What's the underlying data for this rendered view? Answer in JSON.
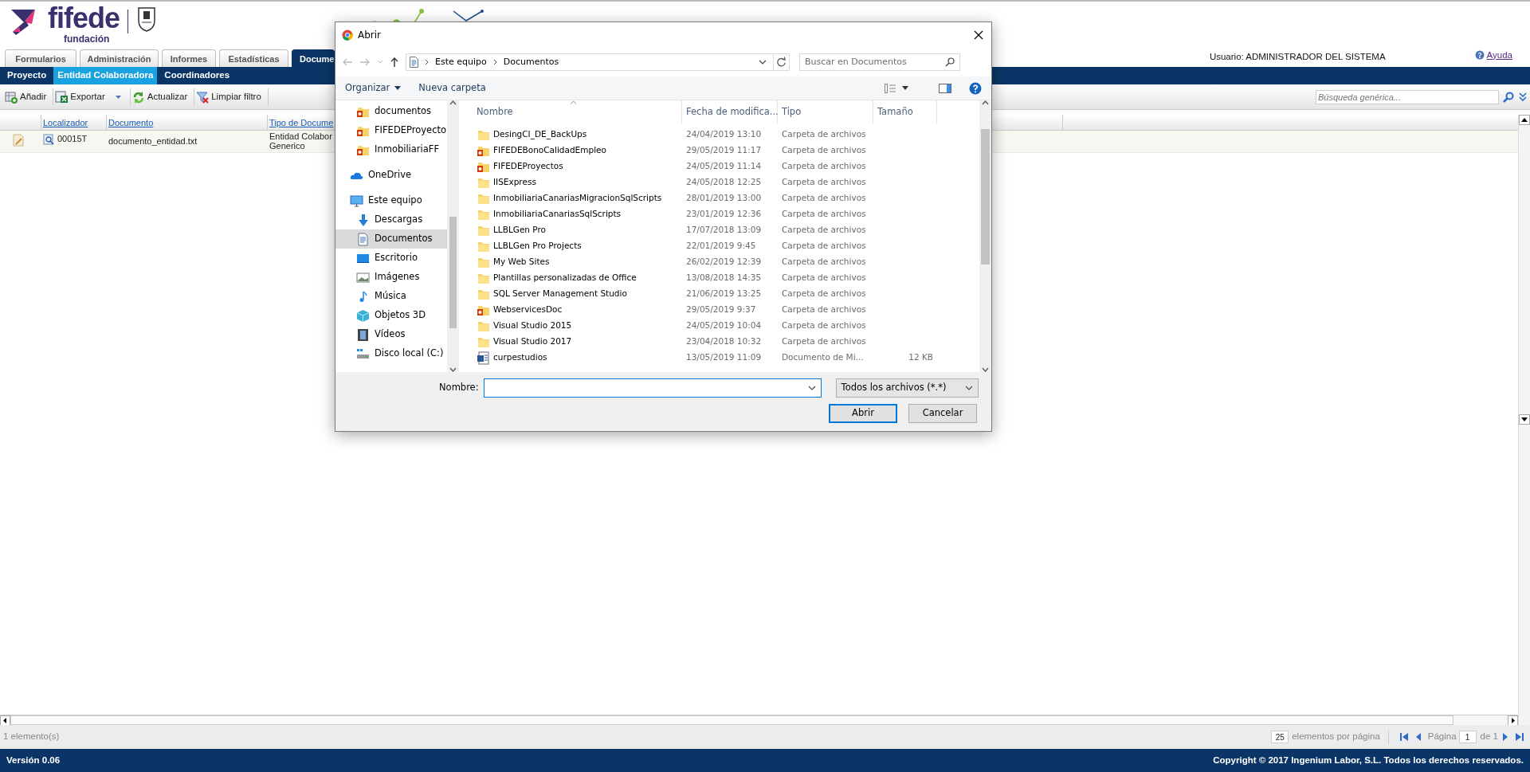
{
  "app": {
    "logo_text": "fifede",
    "logo_subtext": "fundación",
    "user": "Usuario: ADMINISTRADOR DEL SISTEMA",
    "help_link": "Ayuda"
  },
  "tabs": [
    {
      "label": "Formularios",
      "selected": false
    },
    {
      "label": "Administración",
      "selected": false
    },
    {
      "label": "Informes",
      "selected": false
    },
    {
      "label": "Estadísticas",
      "selected": false
    },
    {
      "label": "Docume",
      "selected": true
    }
  ],
  "subnav": [
    {
      "label": "Proyecto",
      "selected": false
    },
    {
      "label": "Entidad Colaboradora",
      "selected": true
    },
    {
      "label": "Coordinadores",
      "selected": false
    }
  ],
  "toolbar": {
    "buttons": [
      {
        "label": "Añadir",
        "kind": "add",
        "dropdown": false
      },
      {
        "label": "Exportar",
        "kind": "export",
        "dropdown": true
      },
      {
        "label": "Actualizar",
        "kind": "refresh",
        "dropdown": false
      },
      {
        "label": "Limpiar filtro",
        "kind": "clear-filter",
        "dropdown": false
      }
    ],
    "search": {
      "placeholder": "Búsqueda genérica..."
    }
  },
  "grid": {
    "columns": [
      "Localizador",
      "Documento",
      "Tipo de Docume"
    ],
    "rows": [
      {
        "localizador": "00015T",
        "documento": "documento_entidad.txt",
        "tipo": [
          "Entidad Colabor",
          "Generico"
        ]
      }
    ]
  },
  "status": {
    "count": "1 elemento(s)",
    "page_size": "25",
    "page_size_label": "elementos por página",
    "page_label": "Página",
    "page": "1",
    "page_total": "de 1"
  },
  "footer": {
    "version": "Versión 0.06",
    "copyright": "Copyright © 2017 Ingenium Labor, S.L. Todos los derechos reservados."
  },
  "dialog": {
    "title": "Abrir",
    "breadcrumb": [
      "Este equipo",
      "Documentos"
    ],
    "search_placeholder": "Buscar en Documentos",
    "commands": [
      {
        "label": "Organizar",
        "dropdown": true
      },
      {
        "label": "Nueva carpeta",
        "dropdown": false
      }
    ],
    "nav": {
      "pinned": [
        {
          "label": "documentos",
          "kind": "office-folder",
          "selected": false
        },
        {
          "label": "FIFEDEProyecto",
          "kind": "office-folder",
          "selected": false
        },
        {
          "label": "InmobiliariaFF",
          "kind": "office-folder",
          "selected": false
        }
      ],
      "places": [
        {
          "label": "OneDrive",
          "kind": "cloud",
          "selected": false
        },
        {
          "label": "Este equipo",
          "kind": "pc",
          "selected": false,
          "children": [
            {
              "label": "Descargas",
              "kind": "downloads",
              "selected": false
            },
            {
              "label": "Documentos",
              "kind": "documents",
              "selected": true
            },
            {
              "label": "Escritorio",
              "kind": "desktop",
              "selected": false
            },
            {
              "label": "Imágenes",
              "kind": "pictures",
              "selected": false
            },
            {
              "label": "Música",
              "kind": "music",
              "selected": false
            },
            {
              "label": "Objetos 3D",
              "kind": "objects3d",
              "selected": false
            },
            {
              "label": "Vídeos",
              "kind": "videos",
              "selected": false
            },
            {
              "label": "Disco local (C:)",
              "kind": "drive",
              "selected": false
            }
          ]
        }
      ]
    },
    "columns": [
      {
        "label": "Nombre",
        "sorted": true
      },
      {
        "label": "Fecha de modifica...",
        "sorted": false
      },
      {
        "label": "Tipo",
        "sorted": false
      },
      {
        "label": "Tamaño",
        "sorted": false
      }
    ],
    "files": [
      {
        "name": "DesingCI_DE_BackUps",
        "date": "24/04/2019 13:10",
        "type": "Carpeta de archivos",
        "kind": "folder"
      },
      {
        "name": "FIFEDEBonoCalidadEmpleo",
        "date": "29/05/2019 11:17",
        "type": "Carpeta de archivos",
        "kind": "office-folder"
      },
      {
        "name": "FIFEDEProyectos",
        "date": "24/05/2019 11:14",
        "type": "Carpeta de archivos",
        "kind": "office-folder"
      },
      {
        "name": "IISExpress",
        "date": "24/05/2018 12:25",
        "type": "Carpeta de archivos",
        "kind": "folder"
      },
      {
        "name": "InmobiliariaCanariasMigracionSqlScripts",
        "date": "28/01/2019 13:00",
        "type": "Carpeta de archivos",
        "kind": "folder"
      },
      {
        "name": "InmobiliariaCanariasSqlScripts",
        "date": "23/01/2019 12:36",
        "type": "Carpeta de archivos",
        "kind": "folder"
      },
      {
        "name": "LLBLGen Pro",
        "date": "17/07/2018 13:09",
        "type": "Carpeta de archivos",
        "kind": "folder"
      },
      {
        "name": "LLBLGen Pro Projects",
        "date": "22/01/2019 9:45",
        "type": "Carpeta de archivos",
        "kind": "folder"
      },
      {
        "name": "My Web Sites",
        "date": "26/02/2019 12:39",
        "type": "Carpeta de archivos",
        "kind": "folder"
      },
      {
        "name": "Plantillas personalizadas de Office",
        "date": "13/08/2018 14:35",
        "type": "Carpeta de archivos",
        "kind": "folder"
      },
      {
        "name": "SQL Server Management Studio",
        "date": "21/06/2019 13:25",
        "type": "Carpeta de archivos",
        "kind": "folder"
      },
      {
        "name": "WebservicesDoc",
        "date": "29/05/2019 9:37",
        "type": "Carpeta de archivos",
        "kind": "office-folder"
      },
      {
        "name": "Visual Studio 2015",
        "date": "24/05/2019 10:04",
        "type": "Carpeta de archivos",
        "kind": "folder"
      },
      {
        "name": "Visual Studio 2017",
        "date": "23/04/2018 10:32",
        "type": "Carpeta de archivos",
        "kind": "folder"
      },
      {
        "name": "curpestudios",
        "date": "13/05/2019 11:09",
        "type": "Documento de Mi...",
        "size": "12 KB",
        "kind": "document"
      }
    ],
    "filename_label": "Nombre:",
    "filter": "Todos los archivos (*.*)",
    "buttons": [
      {
        "label": "Abrir",
        "default": true
      },
      {
        "label": "Cancelar",
        "default": false
      }
    ]
  }
}
